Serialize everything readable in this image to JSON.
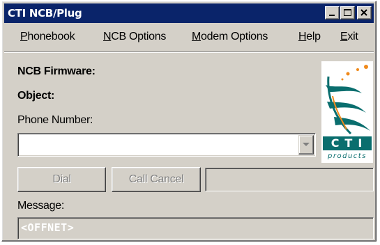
{
  "window": {
    "title": "CTI NCB/Plug"
  },
  "title_buttons": {
    "minimize_icon": "minimize-icon",
    "maximize_icon": "maximize-icon",
    "close_icon": "close-icon"
  },
  "menu": {
    "items": [
      {
        "label": "Phonebook"
      },
      {
        "label": "NCB Options"
      },
      {
        "label": "Modem Options"
      },
      {
        "label": "Help"
      },
      {
        "label": "Exit"
      }
    ]
  },
  "info": {
    "firmware_label": "NCB Firmware:",
    "object_label": "Object:"
  },
  "phone": {
    "label": "Phone Number:",
    "value": ""
  },
  "buttons": {
    "dial": "Dial",
    "call_cancel": "Call Cancel"
  },
  "status": {
    "value": ""
  },
  "message": {
    "label": "Message:",
    "value": "<OFFNET>"
  },
  "logo": {
    "brand": "CTI",
    "tagline": "products",
    "colors": {
      "teal": "#0a6e6e",
      "orange": "#f08a1c"
    }
  },
  "colors": {
    "titlebar": "#0a246a",
    "face": "#d4d0c8",
    "message_text": "#ffffff"
  }
}
